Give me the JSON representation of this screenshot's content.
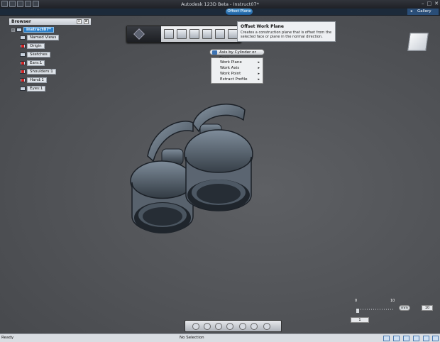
{
  "window": {
    "title": "Autodesk 123D Beta - Instruct07*"
  },
  "ribbon": {
    "active_tool": "Offset Plane",
    "gallery_label": "Gallery"
  },
  "browser": {
    "title": "Browser",
    "root": "Instruct07*",
    "items": [
      {
        "label": "Named Views",
        "icon": "views-icon"
      },
      {
        "label": "Origin",
        "icon": "origin-icon"
      },
      {
        "label": "Sketches",
        "icon": "sketch-icon"
      },
      {
        "label": "Ears:1",
        "icon": "component-icon"
      },
      {
        "label": "Shoulders:1",
        "icon": "component-icon"
      },
      {
        "label": "Hand:1",
        "icon": "component-icon"
      },
      {
        "label": "Eyes:1",
        "icon": "component-icon"
      }
    ]
  },
  "tooltip": {
    "title": "Offset Work Plane",
    "description": "Creates a construction plane that is offset from the selected face or plane in the normal direction."
  },
  "context": {
    "button_label": "Axis by Cylinder or Cone",
    "menu": [
      {
        "label": "Work Plane",
        "submenu": true
      },
      {
        "label": "Work Axis",
        "submenu": true
      },
      {
        "label": "Work Point",
        "submenu": true
      },
      {
        "label": "Extract Profile",
        "submenu": true
      }
    ]
  },
  "unit_control": {
    "scale_min": "0",
    "scale_max": "10",
    "unit": "mm",
    "value": "10",
    "field_value": "1"
  },
  "status": {
    "ready": "Ready",
    "selection": "No Selection"
  },
  "colors": {
    "accent": "#2a7fc9",
    "model_face": "#6f7d8b",
    "model_dark": "#1d2329"
  }
}
